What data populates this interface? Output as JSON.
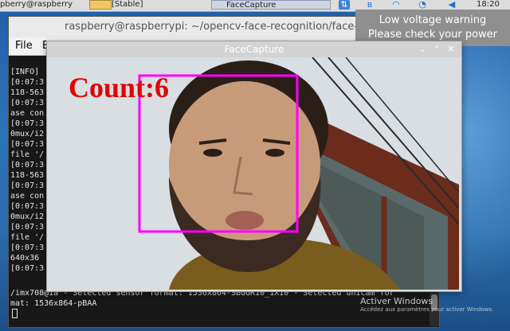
{
  "taskbar": {
    "left_text": "pberry@raspberry",
    "folder_text": "[Stable]",
    "app_button": "FaceCapture",
    "clock": "18:20"
  },
  "notification": {
    "line1": "Low voltage warning",
    "line2": "Please check your power supply"
  },
  "terminal": {
    "title": "raspberry@raspberrypi: ~/opencv-face-recognition/face-detec",
    "menu": [
      "File",
      "E"
    ],
    "lines": [
      " [INFO]",
      "[0:07:3",
      "118-563",
      "[0:07:3",
      "ase con",
      "[0:07:3",
      "0mux/i2",
      "[0:07:3",
      "file '/",
      "[0:07:3",
      "118-563",
      "[0:07:3",
      "ase con",
      "[0:07:3",
      "0mux/i2",
      "[0:07:3",
      "file '/",
      "[0:07:3",
      " 640x36",
      "[0:07:3",
      "/imx708@1a - Selected sensor format: 1536x864-SBGGR10_1X10 - Selected unicam for",
      "mat: 1536x864-pBAA"
    ]
  },
  "facecapture": {
    "title": "FaceCapture",
    "count_label": "Count:6",
    "box_color": "#ff00ff",
    "text_color": "#e00000"
  },
  "watermark": {
    "line1": "Activer Windows",
    "line2": "Accédez aux paramètres pour activer Windows."
  },
  "icons": {
    "tray": [
      "network-icon",
      "bluetooth-icon",
      "volume-icon",
      "upload-icon"
    ],
    "window_controls": [
      "minimize-icon",
      "maximize-icon",
      "close-icon"
    ]
  }
}
